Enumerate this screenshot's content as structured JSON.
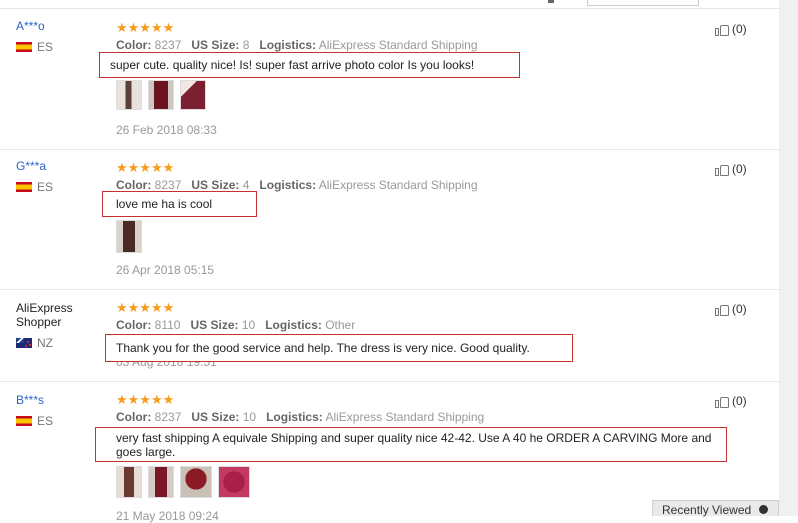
{
  "reviews": [
    {
      "user": "A***o",
      "country": "ES",
      "stars": "★★★★★",
      "color_label": "Color:",
      "color": "8237",
      "size_label": "US Size:",
      "size": "8",
      "logistics_label": "Logistics:",
      "logistics": "AliExpress Standard Shipping",
      "comment": "super cute. quality nice! Is! super fast arrive photo color Is you looks!",
      "date": "26 Feb 2018 08:33",
      "helpful": "(0)",
      "thumb_colors": [
        "#5a4036",
        "#6b1420",
        "#7a2030"
      ]
    },
    {
      "user": "G***a",
      "country": "ES",
      "stars": "★★★★★",
      "color_label": "Color:",
      "color": "8237",
      "size_label": "US Size:",
      "size": "4",
      "logistics_label": "Logistics:",
      "logistics": "AliExpress Standard Shipping",
      "comment": "love me ha is cool",
      "date": "26 Apr 2018 05:15",
      "helpful": "(0)",
      "thumb_colors": [
        "#4a2a25"
      ]
    },
    {
      "user": "AliExpress Shopper",
      "country": "NZ",
      "stars": "★★★★★",
      "color_label": "Color:",
      "color": "8110",
      "size_label": "US Size:",
      "size": "10",
      "logistics_label": "Logistics:",
      "logistics": "Other",
      "comment": "Thank you for the good service and help. The dress is very nice. Good quality.",
      "date": "03 Aug 2018 19:51",
      "helpful": "(0)"
    },
    {
      "user": "B***s",
      "country": "ES",
      "stars": "★★★★★",
      "color_label": "Color:",
      "color": "8237",
      "size_label": "US Size:",
      "size": "10",
      "logistics_label": "Logistics:",
      "logistics": "AliExpress Standard Shipping",
      "comment": "very fast shipping A equivale Shipping and super quality nice 42-42. Use A 40 he ORDER A CARVING More and goes large.",
      "date": "21 May 2018 09:24",
      "helpful": "(0)",
      "thumb_colors": [
        "#6a3a30",
        "#7a1828",
        "#8a1a24",
        "#a8204a"
      ]
    }
  ],
  "recently_viewed": "Recently Viewed",
  "colors": {
    "username": "#2a63c9",
    "stars": "#f79b1a",
    "highlight_box": "#c53030"
  }
}
